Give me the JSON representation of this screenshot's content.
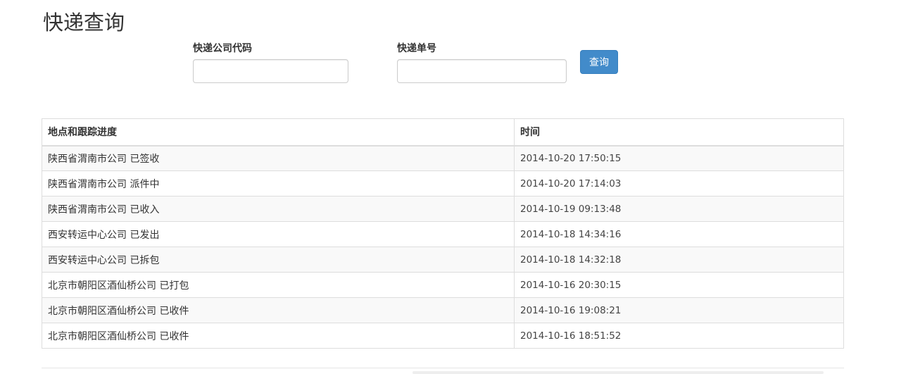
{
  "page": {
    "title": "快递查询"
  },
  "form": {
    "company_label": "快递公司代码",
    "company_value": "",
    "number_label": "快递单号",
    "number_value": "",
    "query_button_label": "查询"
  },
  "table": {
    "headers": {
      "place": "地点和跟踪进度",
      "time": "时间"
    },
    "rows": [
      {
        "place": "陕西省渭南市公司 已签收",
        "time": "2014-10-20 17:50:15"
      },
      {
        "place": "陕西省渭南市公司 派件中",
        "time": "2014-10-20 17:14:03"
      },
      {
        "place": "陕西省渭南市公司 已收入",
        "time": "2014-10-19 09:13:48"
      },
      {
        "place": "西安转运中心公司 已发出",
        "time": "2014-10-18 14:34:16"
      },
      {
        "place": "西安转运中心公司 已拆包",
        "time": "2014-10-18 14:32:18"
      },
      {
        "place": "北京市朝阳区酒仙桥公司 已打包",
        "time": "2014-10-16 20:30:15"
      },
      {
        "place": "北京市朝阳区酒仙桥公司 已收件",
        "time": "2014-10-16 19:08:21"
      },
      {
        "place": "北京市朝阳区酒仙桥公司 已收件",
        "time": "2014-10-16 18:51:52"
      }
    ]
  },
  "colors": {
    "accent": "#428bca",
    "border": "#dddddd",
    "stripe": "#f9f9f9"
  }
}
